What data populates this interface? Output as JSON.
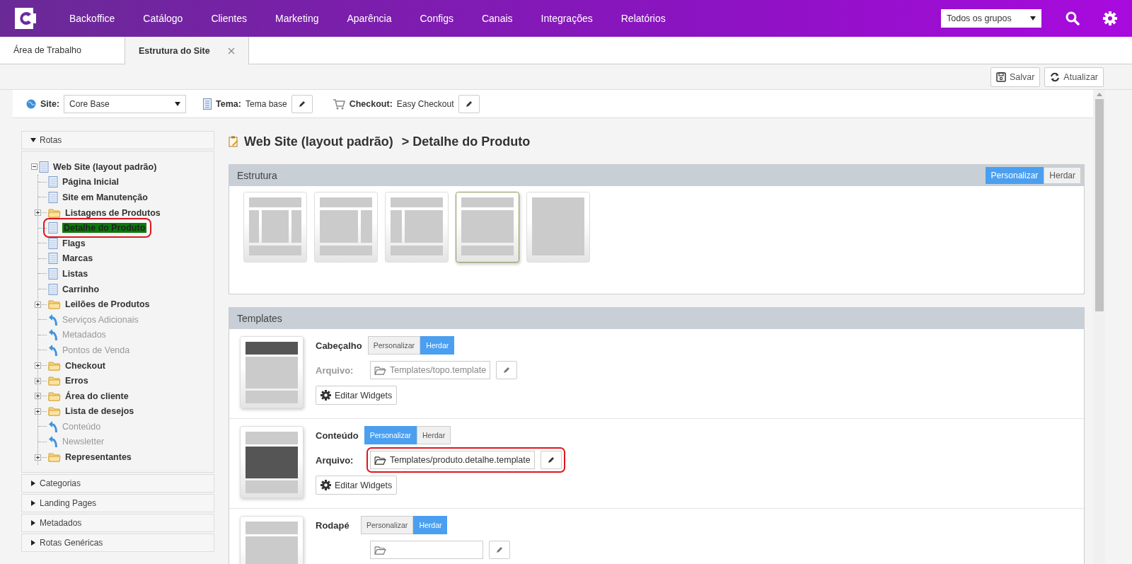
{
  "nav": {
    "menu": [
      "Backoffice",
      "Catálogo",
      "Clientes",
      "Marketing",
      "Aparência",
      "Configs",
      "Canais",
      "Integrações",
      "Relatórios"
    ],
    "group_select": "Todos os grupos"
  },
  "tabs": [
    {
      "label": "Área de Trabalho",
      "selected": false,
      "closable": false
    },
    {
      "label": "Estrutura do Site",
      "selected": true,
      "closable": true
    }
  ],
  "toolbar": [
    "Salvar",
    "Atualizar"
  ],
  "site_bar": {
    "site_label": "Site:",
    "site_value": "Core Base",
    "tema_label": "Tema:",
    "tema_value": "Tema base",
    "checkout_label": "Checkout:",
    "checkout_value": "Easy Checkout"
  },
  "sidebar": {
    "sections": [
      {
        "title": "Rotas",
        "expanded": true
      },
      {
        "title": "Categorias",
        "expanded": false
      },
      {
        "title": "Landing Pages",
        "expanded": false
      },
      {
        "title": "Metadados",
        "expanded": false
      },
      {
        "title": "Rotas Genéricas",
        "expanded": false
      }
    ],
    "tree": {
      "label": "Web Site (layout padrão)",
      "kind": "page",
      "expanded": true,
      "children": [
        {
          "label": "Página Inicial",
          "kind": "page",
          "selected": false
        },
        {
          "label": "Site em Manutenção",
          "kind": "page",
          "selected": false
        },
        {
          "label": "Listagens de Produtos",
          "kind": "folder",
          "selected": false
        },
        {
          "label": "Detalhe do Produto",
          "kind": "page",
          "selected": true
        },
        {
          "label": "Flags",
          "kind": "page",
          "selected": false
        },
        {
          "label": "Marcas",
          "kind": "page",
          "selected": false
        },
        {
          "label": "Listas",
          "kind": "page",
          "selected": false
        },
        {
          "label": "Carrinho",
          "kind": "page",
          "selected": false
        },
        {
          "label": "Leilões de Produtos",
          "kind": "folder",
          "selected": false
        },
        {
          "label": "Serviços Adicionais",
          "kind": "link",
          "selected": false
        },
        {
          "label": "Metadados",
          "kind": "link",
          "selected": false
        },
        {
          "label": "Pontos de Venda",
          "kind": "link",
          "selected": false
        },
        {
          "label": "Checkout",
          "kind": "folder",
          "selected": false
        },
        {
          "label": "Erros",
          "kind": "folder",
          "selected": false
        },
        {
          "label": "Área do cliente",
          "kind": "folder",
          "selected": false
        },
        {
          "label": "Lista de desejos",
          "kind": "folder",
          "selected": false
        },
        {
          "label": "Conteúdo",
          "kind": "link",
          "selected": false
        },
        {
          "label": "Newsletter",
          "kind": "link",
          "selected": false
        },
        {
          "label": "Representantes",
          "kind": "folder",
          "selected": false
        }
      ]
    }
  },
  "page_title": {
    "parent": "Web Site (layout padrão)",
    "current": "> Detalhe do Produto"
  },
  "estrutura": {
    "title": "Estrutura",
    "modes": [
      {
        "label": "Personalizar",
        "selected": true
      },
      {
        "label": "Herdar",
        "selected": false
      }
    ],
    "layouts": [
      {
        "kind": "three-col",
        "selected": false
      },
      {
        "kind": "main-right",
        "selected": false
      },
      {
        "kind": "left-main",
        "selected": false
      },
      {
        "kind": "single",
        "selected": true
      },
      {
        "kind": "blank",
        "selected": false
      }
    ]
  },
  "templates": {
    "title": "Templates",
    "items": [
      {
        "name": "Cabeçalho",
        "kind": "header",
        "modes": [
          {
            "label": "Personalizar",
            "selected": false
          },
          {
            "label": "Herdar",
            "selected": true
          }
        ],
        "file_label": "Arquivo:",
        "file": "Templates/topo.template",
        "disabled": true,
        "highlighted": false,
        "widgets_button": "Editar Widgets"
      },
      {
        "name": "Conteúdo",
        "kind": "content",
        "modes": [
          {
            "label": "Personalizar",
            "selected": true
          },
          {
            "label": "Herdar",
            "selected": false
          }
        ],
        "file_label": "Arquivo:",
        "file": "Templates/produto.detalhe.template",
        "disabled": false,
        "highlighted": true,
        "widgets_button": "Editar Widgets"
      },
      {
        "name": "Rodapé",
        "kind": "footer",
        "modes": [
          {
            "label": "Personalizar",
            "selected": false
          },
          {
            "label": "Herdar",
            "selected": true
          }
        ],
        "disabled": true,
        "highlighted": false
      }
    ]
  }
}
